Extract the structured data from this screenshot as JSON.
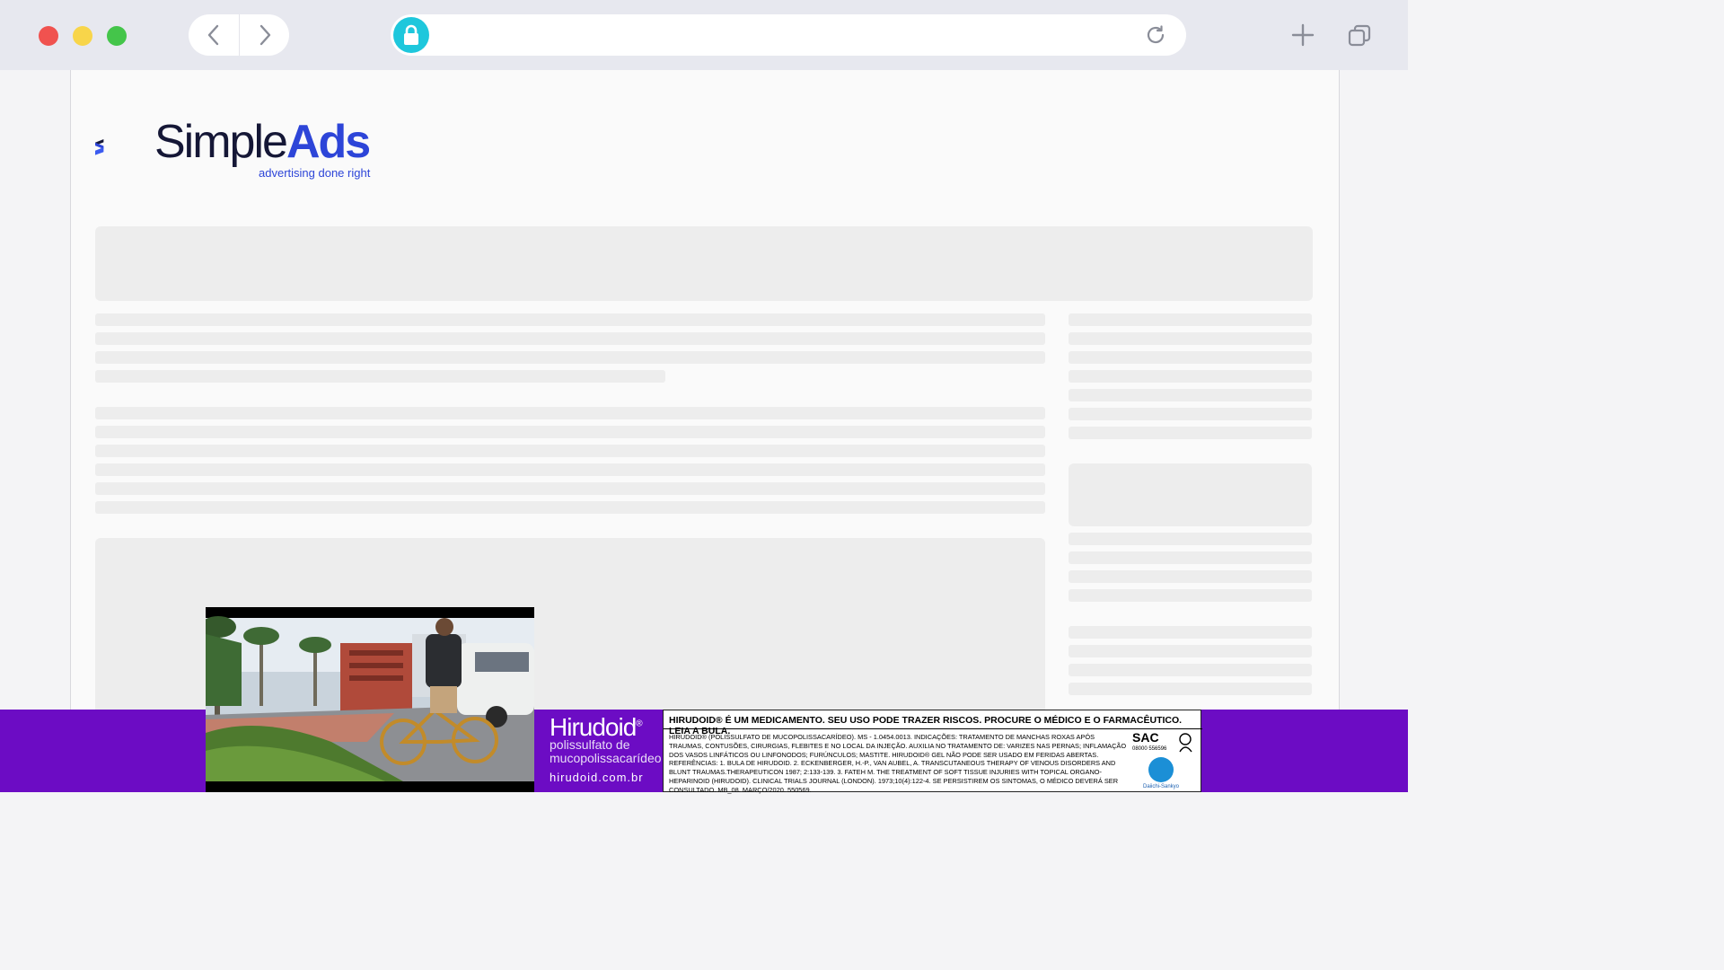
{
  "browser": {
    "icons": {
      "back": "chevron-left-icon",
      "forward": "chevron-right-icon",
      "lock": "lock-icon",
      "reload": "reload-icon",
      "new_tab": "plus-icon",
      "tabs": "tabs-icon"
    },
    "url": ""
  },
  "logo": {
    "simple": "Simple",
    "ads": "Ads",
    "tagline": "advertising done right",
    "colors": {
      "dark": "#151736",
      "accent": "#2d45d8"
    }
  },
  "ad": {
    "brand": "Hirudoid",
    "registered": "®",
    "subtitle_line1": "polissulfato de",
    "subtitle_line2": "mucopolissacarídeo",
    "website": "hirudoid.com.br",
    "warning": "HIRUDOID® É UM MEDICAMENTO. SEU USO PODE TRAZER RISCOS. PROCURE O MÉDICO E O FARMACÊUTICO. LEIA A BULA.",
    "legal_text": "HIRUDOID® (POLISSULFATO DE MUCOPOLISSACARÍDEO). MS - 1.0454.0013. INDICAÇÕES: TRATAMENTO DE MANCHAS ROXAS APÓS TRAUMAS, CONTUSÕES, CIRURGIAS, FLEBITES E NO LOCAL DA INJEÇÃO. AUXILIA NO TRATAMENTO DE: VARIZES NAS PERNAS; INFLAMAÇÃO DOS VASOS LINFÁTICOS OU LINFONODOS; FURÚNCULOS; MASTITE. HIRUDOID® GEL NÃO PODE SER USADO EM FERIDAS ABERTAS. REFERÊNCIAS: 1. BULA DE HIRUDOID. 2. ECKENBERGER, H.-P., VAN AUBEL, A. TRANSCUTANEOUS THERAPY OF VENOUS DISORDERS AND BLUNT TRAUMAS.THERAPEUTICON 1987; 2:133-139. 3. FATEH M. THE TREATMENT OF SOFT TISSUE INJURIES WITH TOPICAL ORGANO-HEPARINOID (HIRUDOID). CLINICAL TRIALS JOURNAL (LONDON). 1973;10(4):122-4. SE PERSISTIREM OS SINTOMAS, O MÉDICO DEVERÁ SER CONSULTADO. MB_08. MARÇO/2020. 550569.",
    "sac": "SAC",
    "sac_number": "08000 556596",
    "maker": "Daiichi-Sankyo",
    "colors": {
      "strip": "#6c0cc4"
    }
  }
}
